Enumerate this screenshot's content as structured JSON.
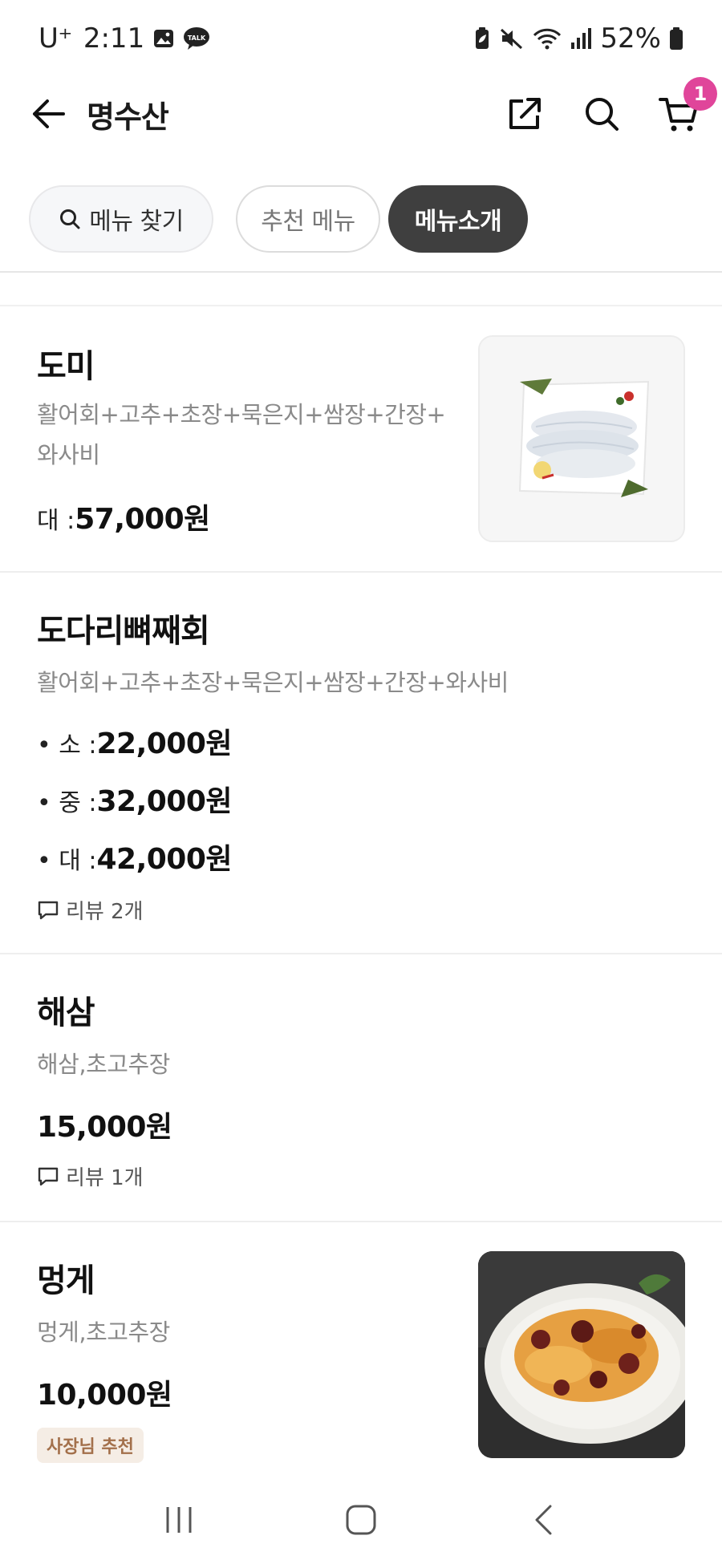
{
  "status_bar": {
    "carrier": "U⁺",
    "time": "2:11",
    "battery": "52%",
    "icons": [
      "image-icon",
      "talk-icon",
      "battery-saver-icon",
      "mute-icon",
      "wifi-icon",
      "signal-icon",
      "battery-icon"
    ],
    "talk_label": "TALK"
  },
  "header": {
    "title": "명수산",
    "cart_count": "1",
    "accent_color": "#e0459a"
  },
  "chips": {
    "search_label": "메뉴 찾기",
    "recommended_label": "추천 메뉴",
    "intro_label": "메뉴소개"
  },
  "menu": {
    "items": [
      {
        "name": "도미",
        "desc_line1": "활어회+고추+초장+묵은지+쌈장+간장+",
        "desc_line2": "와사비",
        "prices": [
          {
            "label": "대 : ",
            "value": "57,000원"
          }
        ]
      },
      {
        "name": "도다리뼈째회",
        "desc_line1": "활어회+고추+초장+묵은지+쌈장+간장+와사비",
        "prices": [
          {
            "label": "• 소 : ",
            "value": "22,000원"
          },
          {
            "label": "• 중 : ",
            "value": "32,000원"
          },
          {
            "label": "• 대 : ",
            "value": "42,000원"
          }
        ],
        "review": "리뷰 2개"
      },
      {
        "name": "해삼",
        "desc_line1": "해삼,초고추장",
        "prices": [
          {
            "label": "",
            "value": "15,000원"
          }
        ],
        "review": "리뷰 1개"
      },
      {
        "name": "멍게",
        "desc_line1": "멍게,초고추장",
        "prices": [
          {
            "label": "",
            "value": "10,000원"
          }
        ],
        "badge": "사장님 추천"
      }
    ]
  }
}
